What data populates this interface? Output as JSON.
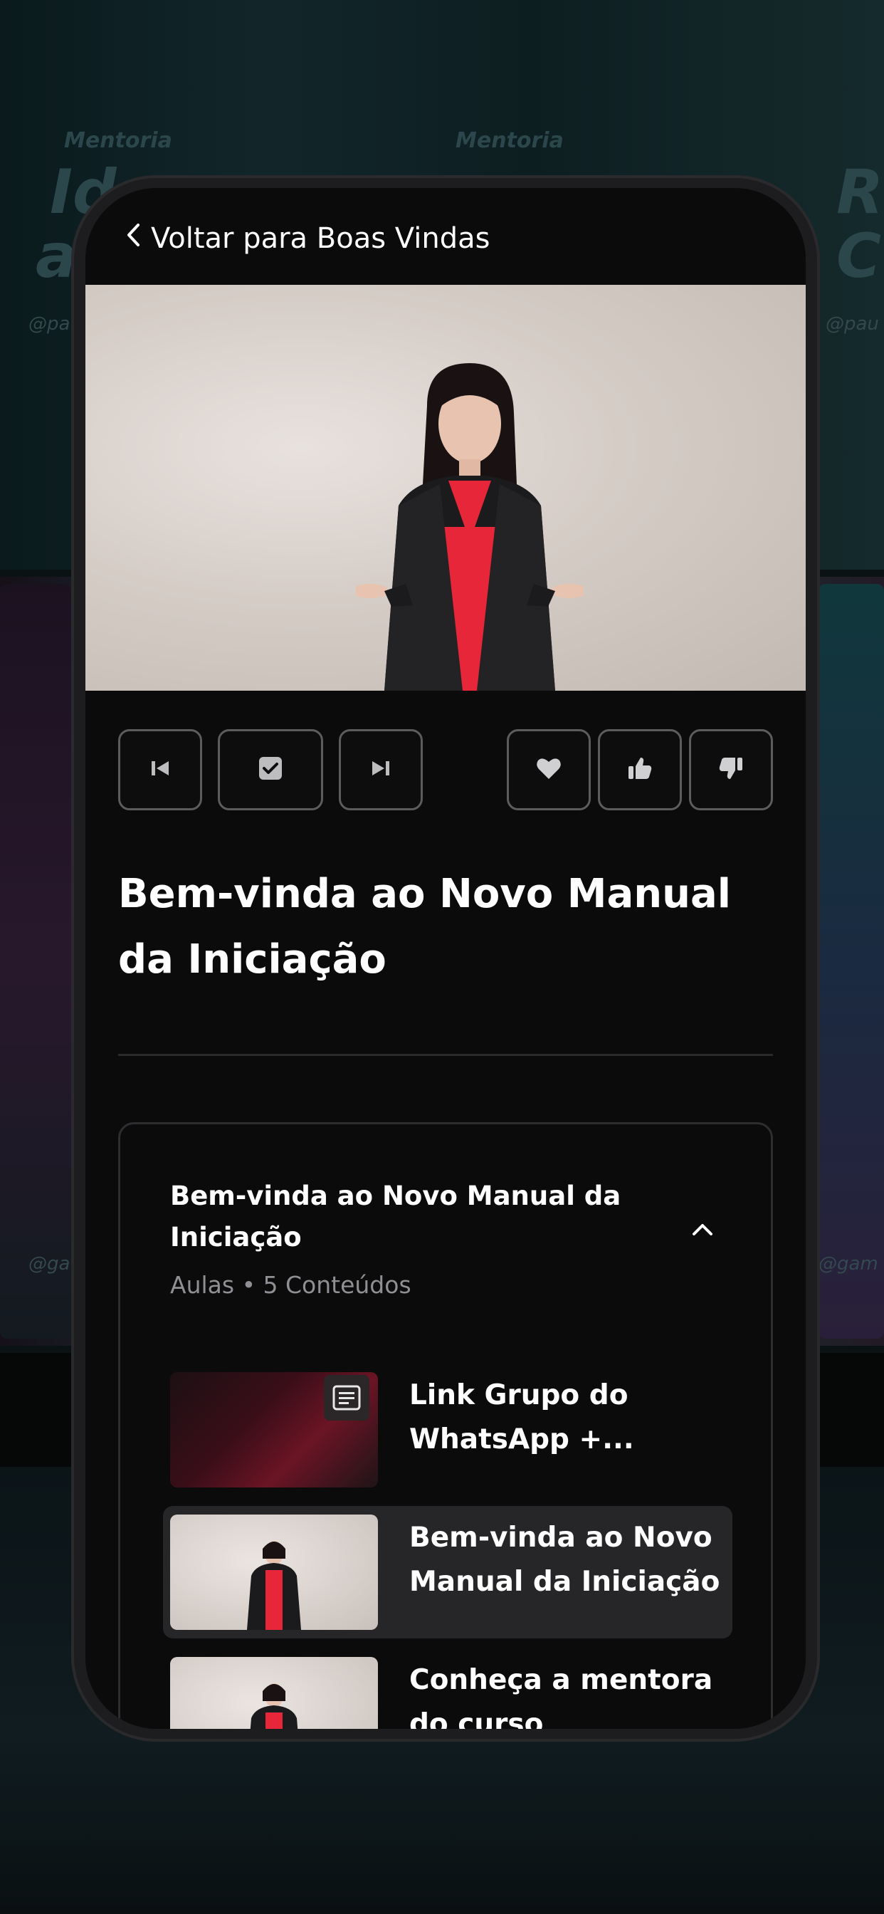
{
  "background": {
    "texts": [
      "Mentoria",
      "Ide",
      "a",
      "Mentoria",
      "R",
      "C"
    ],
    "handles": [
      "@pa",
      "@pau",
      "@ga",
      "@gam"
    ]
  },
  "header": {
    "back_label": "Voltar para Boas Vindas",
    "back_icon": "chevron-left-icon"
  },
  "player": {
    "controls": [
      {
        "icon": "skip-previous-icon"
      },
      {
        "icon": "checkbox-checked-icon"
      },
      {
        "icon": "skip-next-icon"
      },
      {
        "icon": "heart-icon"
      },
      {
        "icon": "thumbs-up-icon"
      },
      {
        "icon": "thumbs-down-icon"
      }
    ]
  },
  "lesson": {
    "title": "Bem-vinda ao Novo Manual da Iniciação"
  },
  "module": {
    "title": "Bem-vinda ao Novo Manual da Iniciação",
    "subtitle": "Aulas • 5 Conteúdos",
    "collapse_icon": "chevron-up-icon",
    "items": [
      {
        "label": "Link Grupo do WhatsApp +...",
        "type": "document",
        "icon": "document-icon",
        "active": false
      },
      {
        "label": "Bem-vinda ao Novo Manual da Iniciação",
        "type": "video",
        "active": true
      },
      {
        "label": "Conheça a mentora do curso",
        "type": "video",
        "active": false
      }
    ]
  },
  "colors": {
    "accent_red": "#e8263a",
    "screen_bg": "#0b0b0c",
    "active_row": "#262628"
  }
}
